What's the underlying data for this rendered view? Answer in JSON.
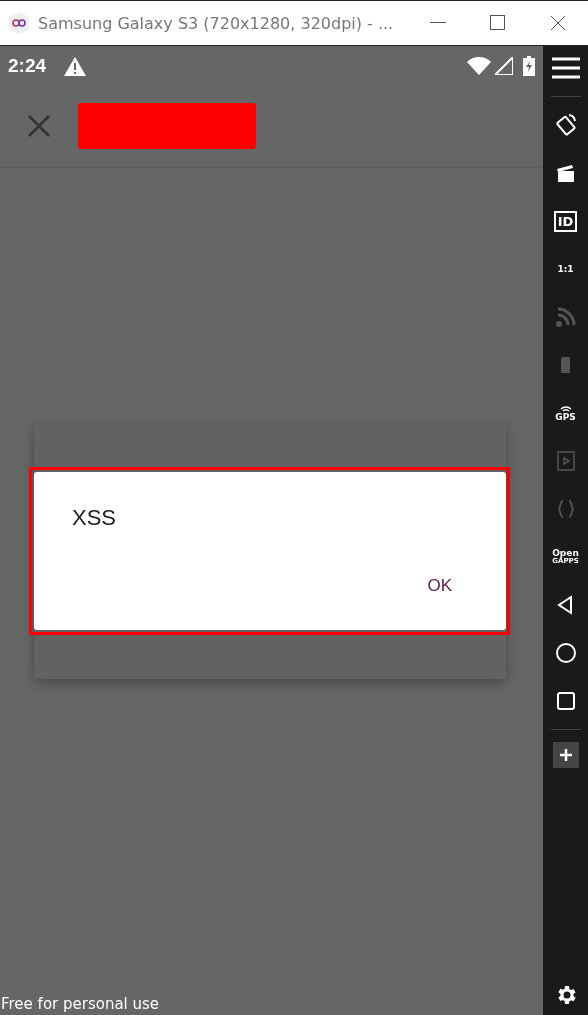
{
  "window": {
    "title": "Samsung Galaxy S3 (720x1280, 320dpi) - ..."
  },
  "status_bar": {
    "time": "2:24"
  },
  "alert": {
    "message": "XSS",
    "button": "OK"
  },
  "footer": {
    "notice": "Free for personal use"
  },
  "sidebar": {
    "tools": [
      {
        "kind": "rotate",
        "disabled": false
      },
      {
        "kind": "clapper",
        "disabled": false
      },
      {
        "kind": "id",
        "label": "ID",
        "disabled": false
      },
      {
        "kind": "scale",
        "label": "1:1",
        "disabled": false
      },
      {
        "kind": "feed",
        "disabled": true
      },
      {
        "kind": "sim",
        "disabled": true
      },
      {
        "kind": "gps",
        "label": "GPS",
        "disabled": false
      },
      {
        "kind": "film",
        "disabled": true
      },
      {
        "kind": "braces",
        "disabled": true
      },
      {
        "kind": "gapps",
        "label": "Open",
        "label2": "GAPPS",
        "disabled": false
      },
      {
        "kind": "back",
        "disabled": false
      },
      {
        "kind": "home",
        "disabled": false
      },
      {
        "kind": "recents",
        "disabled": false
      }
    ]
  }
}
